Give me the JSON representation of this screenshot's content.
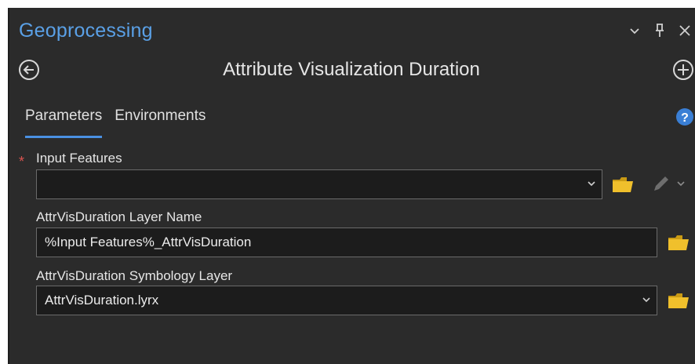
{
  "header": {
    "title": "Geoprocessing",
    "controls": [
      "chevron-down-icon",
      "pin-icon",
      "close-icon"
    ]
  },
  "tool": {
    "title": "Attribute Visualization Duration",
    "back_icon": "back-circle-icon",
    "add_icon": "add-circle-icon"
  },
  "tabs": [
    {
      "label": "Parameters",
      "active": true
    },
    {
      "label": "Environments",
      "active": false
    }
  ],
  "help_icon": "help-circle-icon",
  "params": [
    {
      "label": "Input Features",
      "required": true,
      "required_marker": "*",
      "value": "",
      "has_dropdown": true,
      "icons": [
        "folder-icon",
        "pencil-icon"
      ]
    },
    {
      "label": "AttrVisDuration Layer Name",
      "required": false,
      "value": "%Input Features%_AttrVisDuration",
      "has_dropdown": false,
      "icons": [
        "folder-icon"
      ]
    },
    {
      "label": "AttrVisDuration Symbology Layer",
      "required": false,
      "value": "AttrVisDuration.lyrx",
      "has_dropdown": true,
      "icons": [
        "folder-icon"
      ]
    }
  ],
  "colors": {
    "panel_bg": "#2b2b2b",
    "accent": "#5aa0e6",
    "tab_underline": "#4a90e2",
    "required": "#d9534f",
    "folder": "#e8b923"
  }
}
